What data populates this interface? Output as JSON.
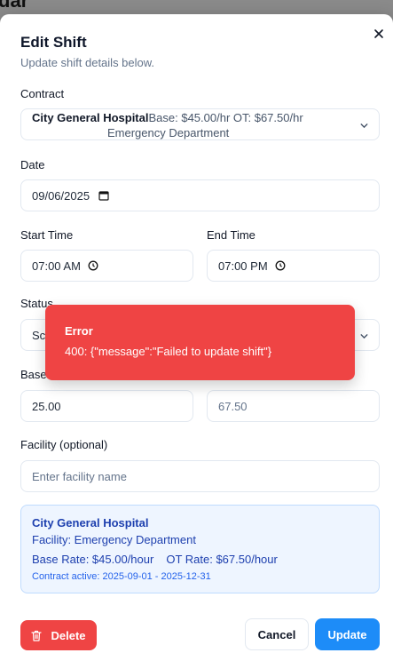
{
  "backdrop": {
    "title_fragment": "dar"
  },
  "modal": {
    "title": "Edit Shift",
    "subtitle": "Update shift details below."
  },
  "contract": {
    "label": "Contract",
    "name": "City General Hospital",
    "rates": "Base: $45.00/hr  OT: $67.50/hr",
    "department": "Emergency Department"
  },
  "date": {
    "label": "Date",
    "value": "09/06/2025"
  },
  "start_time": {
    "label": "Start Time",
    "value": "07:00 AM"
  },
  "end_time": {
    "label": "End Time",
    "value": "07:00 PM"
  },
  "status": {
    "label": "Status",
    "value_visible": "Sc"
  },
  "base_rate": {
    "label_visible": "Base",
    "value": "25.00"
  },
  "ot_rate": {
    "value": "67.50"
  },
  "facility": {
    "label": "Facility (optional)",
    "placeholder": "Enter facility name"
  },
  "info": {
    "title": "City General Hospital",
    "facility": "Facility: Emergency Department",
    "base_rate": "Base Rate: $45.00/hour",
    "ot_rate": "OT Rate: $67.50/hour",
    "active": "Contract active: 2025-09-01 - 2025-12-31"
  },
  "buttons": {
    "delete": "Delete",
    "cancel": "Cancel",
    "update": "Update"
  },
  "toast": {
    "title": "Error",
    "message": "400: {\"message\":\"Failed to update shift\"}"
  },
  "colors": {
    "danger": "#ef4444",
    "primary": "#1d8cf8",
    "info_bg": "#eef5ff",
    "info_text": "#1e40af"
  }
}
